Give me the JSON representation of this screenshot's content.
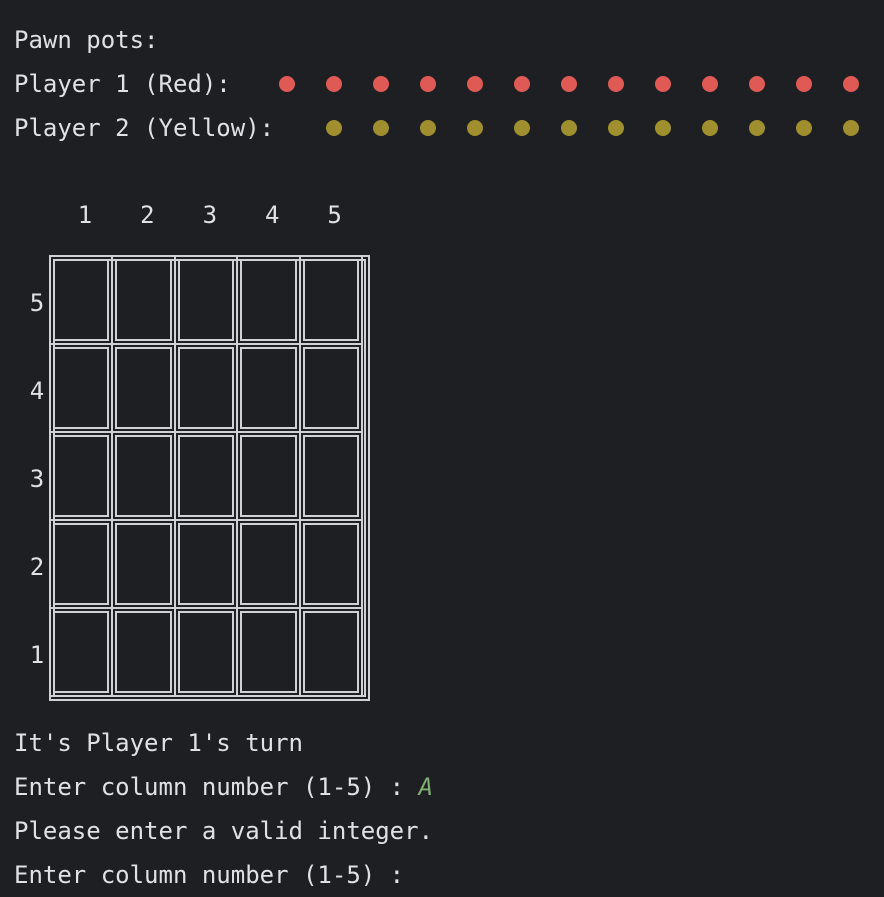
{
  "console": {
    "pawn_pots_label": "Pawn pots:",
    "player1_label": "Player 1 (Red):",
    "player2_label": "Player 2 (Yellow):",
    "player1_pawn_count": 13,
    "player2_pawn_count": 12,
    "player1_color": "#e05a55",
    "player2_color": "#a08f2e",
    "turn_text": "It's Player 1's turn",
    "prompt1": "Enter column number (1-5) : ",
    "input_value": "A",
    "error_text": "Please enter a valid integer.",
    "prompt2": "Enter column number (1-5) :"
  },
  "board": {
    "columns": [
      "1",
      "2",
      "3",
      "4",
      "5"
    ],
    "rows": [
      "5",
      "4",
      "3",
      "2",
      "1"
    ],
    "cells": [
      [
        "",
        "",
        "",
        "",
        ""
      ],
      [
        "",
        "",
        "",
        "",
        ""
      ],
      [
        "",
        "",
        "",
        "",
        ""
      ],
      [
        "",
        "",
        "",
        "",
        ""
      ],
      [
        "",
        "",
        "",
        "",
        ""
      ]
    ]
  }
}
